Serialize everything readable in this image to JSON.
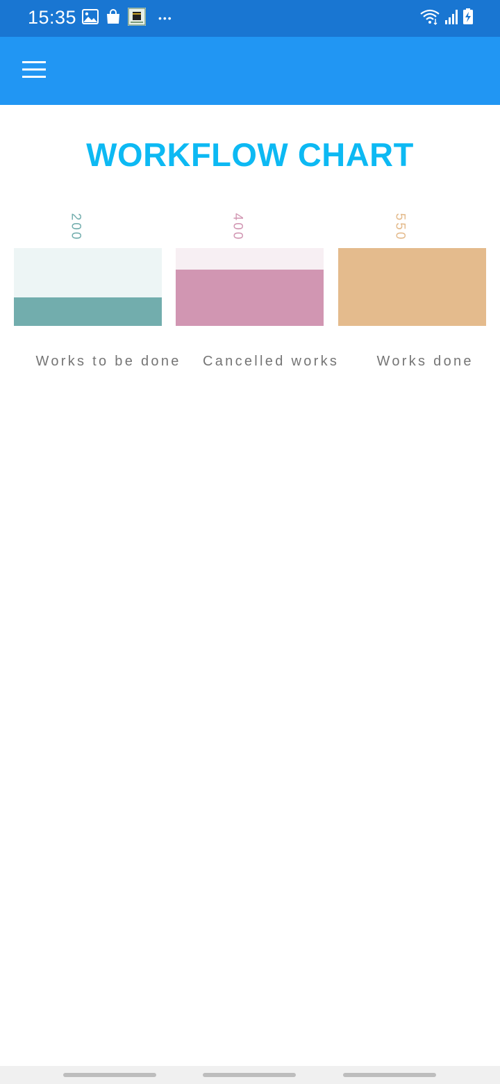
{
  "status_bar": {
    "time": "15:35",
    "left_icons": [
      "image-icon",
      "shopping-bag-icon",
      "kaaba-app-icon",
      "more-dots-icon"
    ],
    "right_icons": [
      "wifi-icon",
      "signal-icon",
      "battery-charging-icon"
    ],
    "more_dots": "•••"
  },
  "app_bar": {
    "menu_icon": "hamburger-menu-icon",
    "background": "#2196f3"
  },
  "chart_data": {
    "type": "bar",
    "title": "WORKFLOW CHART",
    "categories": [
      "Works to be done",
      "Cancelled works",
      "Works done"
    ],
    "values": [
      200,
      400,
      550
    ],
    "value_labels": [
      "200",
      "400",
      "550"
    ],
    "ylim": [
      0,
      550
    ],
    "colors": [
      "#72adad",
      "#d196b2",
      "#e4bb8d"
    ],
    "background_colors": [
      "#edf5f5",
      "#f7eff3",
      "#f7ede3"
    ],
    "grid": false,
    "legend": "none"
  },
  "colors": {
    "status_bar": "#1976d2",
    "title": "#0db9f3",
    "label": "#757575"
  }
}
